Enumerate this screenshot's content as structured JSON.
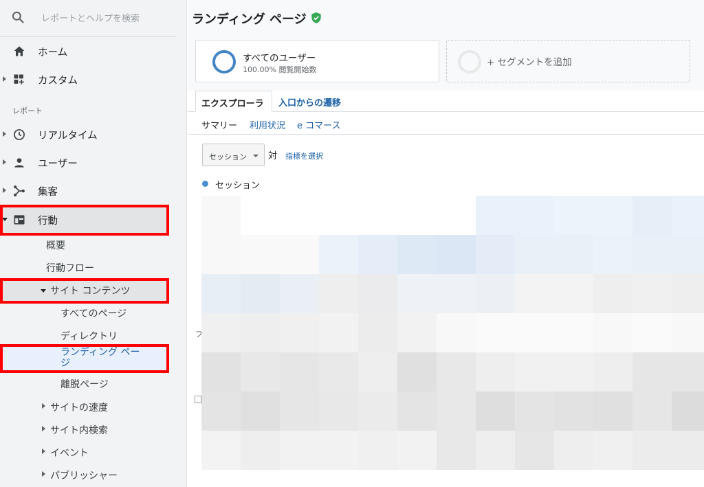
{
  "sidebar": {
    "search_placeholder": "レポートとヘルプを検索",
    "home": "ホーム",
    "custom": "カスタム",
    "section_reports": "レポート",
    "realtime": "リアルタイム",
    "users": "ユーザー",
    "acquisition": "集客",
    "behavior": "行動",
    "behavior_sub": {
      "overview": "概要",
      "behavior_flow": "行動フロー",
      "site_content": "サイト コンテンツ",
      "all_pages": "すべてのページ",
      "directory": "ディレクトリ",
      "landing_pages_line1": "ランディング ペー",
      "landing_pages_line2": "ジ",
      "exit_pages": "離脱ページ",
      "site_speed": "サイトの速度",
      "site_search": "サイト内検索",
      "events": "イベント",
      "publisher": "パブリッシャー"
    }
  },
  "header": {
    "title": "ランディング ページ"
  },
  "segments": {
    "all_users": "すべてのユーザー",
    "all_users_sub": "100.00% 閲覧開始数",
    "add_segment": "+ セグメントを追加"
  },
  "tabs": {
    "explorer": "エクスプローラ",
    "entrance_paths": "入口からの遷移"
  },
  "subnav": {
    "summary": "サマリー",
    "usage": "利用状況",
    "ecommerce": "e コマース"
  },
  "chart_controls": {
    "metric": "セッション",
    "versus": "対",
    "select_metric": "指標を選択",
    "legend": "セッション"
  },
  "edge_glyph": "フ",
  "colors": {
    "accent_link": "#1a5fa6",
    "ring": "#4285c4",
    "highlight_red": "#ff0000",
    "sidebar_bg": "#f1f3f4",
    "verified_green": "#34a853"
  }
}
